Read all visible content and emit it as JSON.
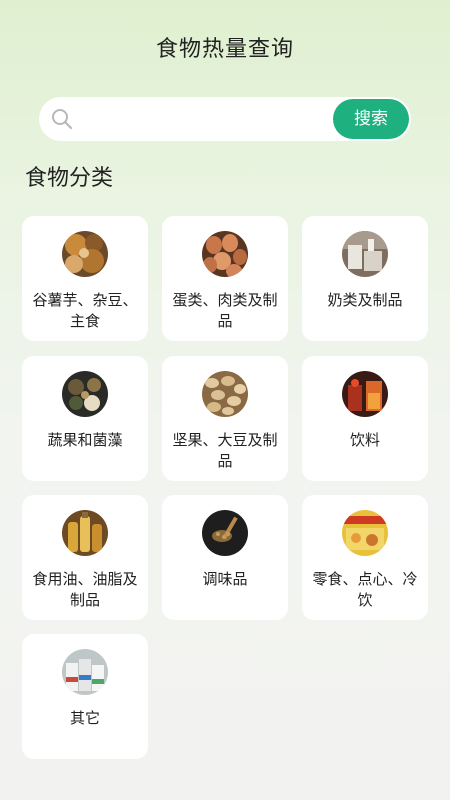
{
  "header": {
    "title": "食物热量查询"
  },
  "search": {
    "placeholder": "",
    "value": "",
    "button_label": "搜索"
  },
  "section": {
    "title": "食物分类"
  },
  "categories": [
    {
      "label": "谷薯芋、杂豆、主食",
      "icon": "grains-food-photo"
    },
    {
      "label": "蛋类、肉类及制品",
      "icon": "eggs-photo"
    },
    {
      "label": "奶类及制品",
      "icon": "dairy-photo"
    },
    {
      "label": "蔬果和菌藻",
      "icon": "vegetables-fruits-photo"
    },
    {
      "label": "坚果、大豆及制品",
      "icon": "nuts-photo"
    },
    {
      "label": "饮料",
      "icon": "drinks-photo"
    },
    {
      "label": "食用油、油脂及制品",
      "icon": "oils-photo"
    },
    {
      "label": "调味品",
      "icon": "seasoning-photo"
    },
    {
      "label": "零食、点心、冷饮",
      "icon": "snacks-photo"
    },
    {
      "label": "其它",
      "icon": "others-photo"
    }
  ],
  "colors": {
    "accent": "#1fb07f",
    "card": "#ffffff",
    "text": "#222222"
  }
}
